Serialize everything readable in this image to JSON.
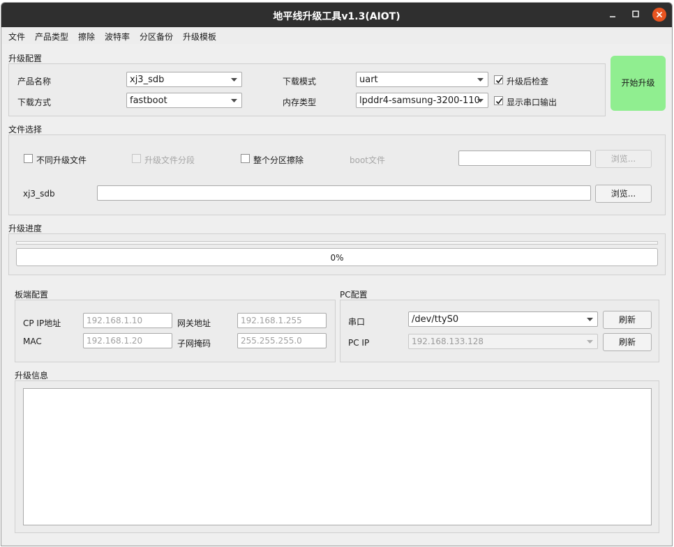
{
  "window": {
    "title": "地平线升级工具v1.3(AIOT)"
  },
  "menu": [
    "文件",
    "产品类型",
    "擦除",
    "波特率",
    "分区备份",
    "升级模板"
  ],
  "upgrade_config": {
    "section_label": "升级配置",
    "product_name_label": "产品名称",
    "product_name_value": "xj3_sdb",
    "download_method_label": "下载方式",
    "download_method_value": "fastboot",
    "download_mode_label": "下载模式",
    "download_mode_value": "uart",
    "memory_type_label": "内存类型",
    "memory_type_value": "lpddr4-samsung-3200-110",
    "check_after_upgrade_label": "升级后检查",
    "check_after_upgrade": true,
    "show_serial_output_label": "显示串口输出",
    "show_serial_output": true,
    "start_button": "开始升级"
  },
  "file_select": {
    "section_label": "文件选择",
    "diff_upgrade_file_label": "不同升级文件",
    "segment_file_label": "升级文件分段",
    "full_partition_erase_label": "整个分区擦除",
    "boot_file_label": "boot文件",
    "boot_file_value": "",
    "browse_disabled_label": "浏览...",
    "xj3_label": "xj3_sdb",
    "xj3_value": "",
    "browse_label": "浏览..."
  },
  "progress": {
    "section_label": "升级进度",
    "value_percent": 0,
    "text": "0%"
  },
  "board_config": {
    "section_label": "板端配置",
    "cp_ip_label": "CP IP地址",
    "cp_ip_placeholder": "192.168.1.10",
    "gateway_label": "网关地址",
    "gateway_placeholder": "192.168.1.255",
    "mac_label": "MAC",
    "mac_placeholder": "192.168.1.20",
    "subnet_label": "子网掩码",
    "subnet_placeholder": "255.255.255.0"
  },
  "pc_config": {
    "section_label": "PC配置",
    "serial_label": "串口",
    "serial_value": "/dev/ttyS0",
    "refresh_label": "刷新",
    "pc_ip_label": "PC IP",
    "pc_ip_value": "192.168.133.128",
    "refresh2_label": "刷新"
  },
  "upgrade_info": {
    "section_label": "升级信息",
    "log": ""
  },
  "colors": {
    "titlebar": "#2f2f2f",
    "close_button": "#e95420",
    "start_button": "#90ee90",
    "progress_fill": "#4a90d9"
  }
}
